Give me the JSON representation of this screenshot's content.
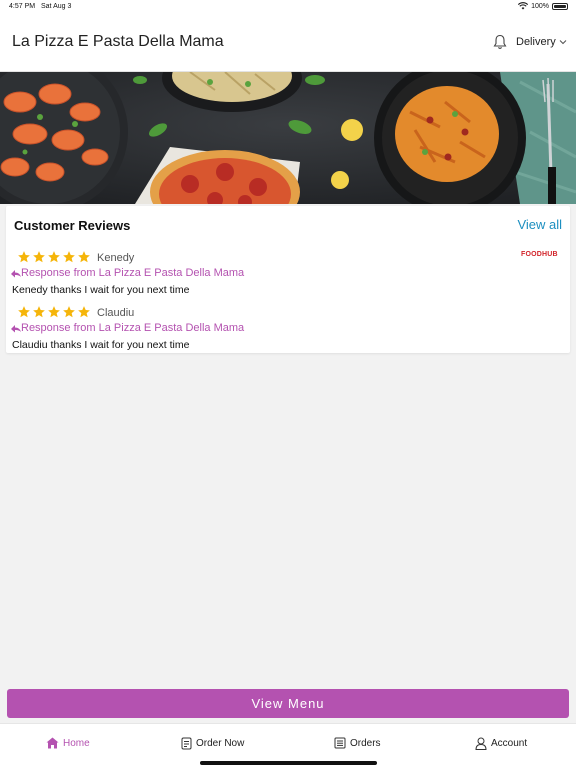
{
  "status_bar": {
    "time": "4:57 PM",
    "date": "Sat Aug 3",
    "battery": "100%"
  },
  "header": {
    "title": "La Pizza E Pasta Della Mama",
    "order_mode": "Delivery",
    "bell_icon": "bell-icon",
    "chevron_icon": "chevron-down-icon"
  },
  "reviews": {
    "heading": "Customer Reviews",
    "view_all": "View all",
    "brand": "FOODHUB",
    "items": [
      {
        "name": "Kenedy",
        "rating": 5,
        "response_label": "Response from La Pizza E Pasta Della Mama",
        "response_text": "Kenedy thanks I wait for you next time"
      },
      {
        "name": "Claudiu",
        "rating": 5,
        "response_label": "Response from La Pizza E Pasta Della Mama",
        "response_text": "Claudiu thanks I wait for you next time"
      }
    ]
  },
  "view_menu": "View Menu",
  "tabs": [
    {
      "label": "Home",
      "icon": "home-icon",
      "active": true
    },
    {
      "label": "Order Now",
      "icon": "order-icon",
      "active": false
    },
    {
      "label": "Orders",
      "icon": "orders-icon",
      "active": false
    },
    {
      "label": "Account",
      "icon": "account-icon",
      "active": false
    }
  ],
  "colors": {
    "accent": "#b452b0",
    "link": "#1c8fc0",
    "star": "#f5b50a",
    "brand": "#d2232a"
  }
}
